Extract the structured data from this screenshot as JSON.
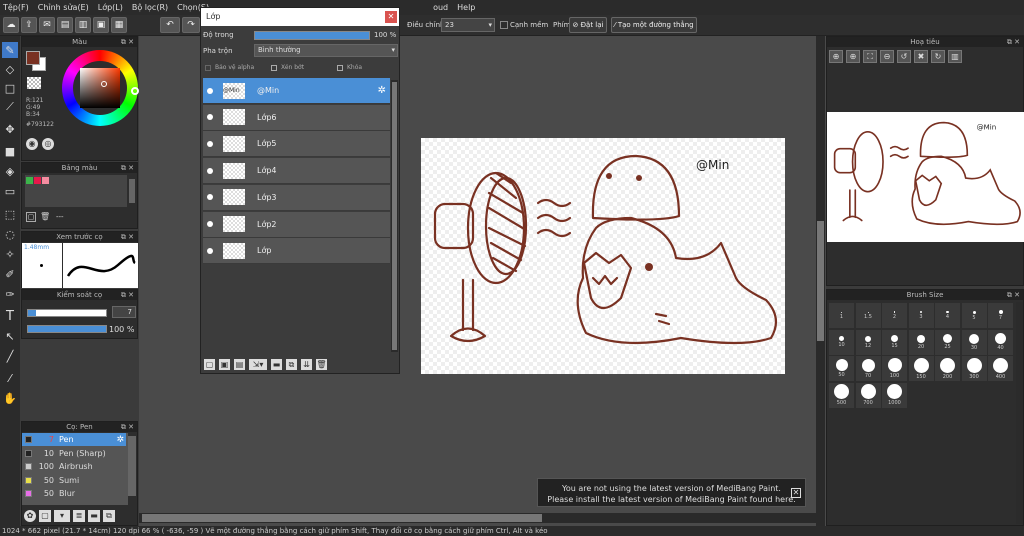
{
  "menu": [
    "Tệp(F)",
    "Chỉnh sửa(E)",
    "Lớp(L)",
    "Bộ lọc(R)",
    "Chọn(S)",
    "oud",
    "Help"
  ],
  "toolbar": {
    "correction_label": "Điều chỉnh",
    "correction_value": "23",
    "sharp_label": "Cạnh mềm",
    "snap_label": "Phím",
    "reset_label": "Đặt lại",
    "line_label": "Tạo một đường thẳng"
  },
  "color_panel": {
    "title": "Màu",
    "r": "R:121",
    "g": "G:49",
    "b": "B:34",
    "hex": "#793122",
    "fg": "#793122",
    "bg": "#ffffff"
  },
  "palette_panel": {
    "title": "Bảng màu",
    "swatches": [
      "#3cb44b",
      "#e6194b",
      "#f58ca0"
    ],
    "entry": "---"
  },
  "preview_panel": {
    "title": "Xem trước cọ",
    "size": "1.48mm"
  },
  "control_panel": {
    "title": "Kiểm soát cọ",
    "size_value": "7",
    "opacity_value": "100 %"
  },
  "pen_panel": {
    "title": "Cọ: Pen",
    "items": [
      {
        "size": "7",
        "name": "Pen",
        "color": "#222222"
      },
      {
        "size": "10",
        "name": "Pen (Sharp)",
        "color": "#222222"
      },
      {
        "size": "100",
        "name": "Airbrush",
        "color": "#cccccc"
      },
      {
        "size": "50",
        "name": "Sumi",
        "color": "#e8e04a"
      },
      {
        "size": "50",
        "name": "Blur",
        "color": "#e86ee8"
      }
    ]
  },
  "layer_window": {
    "title": "Lớp",
    "opacity_label": "Độ trong",
    "opacity_value": "100 %",
    "blend_label": "Pha trộn",
    "blend_value": "Bình thường",
    "alpha_label": "Bảo vệ alpha",
    "clip_label": "Xén bớt",
    "lock_label": "Khóa",
    "layers": [
      {
        "name": "@Min",
        "thumb": "@Min",
        "selected": true
      },
      {
        "name": "Lớp6",
        "thumb": "",
        "selected": false
      },
      {
        "name": "Lớp5",
        "thumb": "",
        "selected": false
      },
      {
        "name": "Lớp4",
        "thumb": "",
        "selected": false
      },
      {
        "name": "Lớp3",
        "thumb": "",
        "selected": false
      },
      {
        "name": "Lớp2",
        "thumb": "",
        "selected": false
      },
      {
        "name": "Lớp",
        "thumb": "",
        "selected": false
      }
    ]
  },
  "canvas": {
    "signature": "@Min"
  },
  "navigator": {
    "title": "Hoạ tiêu",
    "signature": "@Min"
  },
  "brush_size": {
    "title": "Brush Size",
    "sizes": [
      "1",
      "1.5",
      "2",
      "3",
      "4",
      "5",
      "7",
      "10",
      "12",
      "15",
      "20",
      "25",
      "30",
      "40",
      "50",
      "70",
      "100",
      "150",
      "200",
      "300",
      "400",
      "500",
      "700",
      "1000"
    ]
  },
  "notice": {
    "line1": "You are not using the latest version of MediBang Paint.",
    "line2": "Please install the latest version of MediBang Paint found here."
  },
  "status": "1024 * 662 pixel   (21.7 * 14cm)   120 dpi   66 %   ( -636, -59 )   Vẽ một đường thẳng bằng cách giữ phím Shift, Thay đổi cỡ cọ bằng cách giữ phím Ctrl, Alt và kéo"
}
